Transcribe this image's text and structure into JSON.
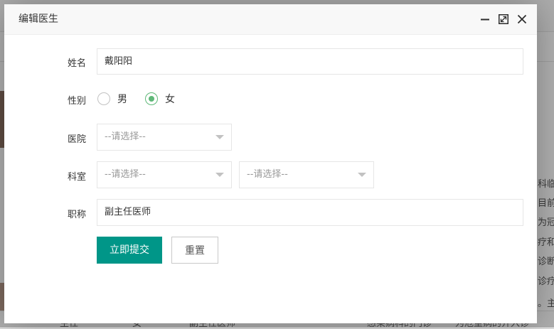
{
  "dialog": {
    "title": "编辑医生",
    "controls": [
      "minimize-icon",
      "maximize-icon",
      "close-icon"
    ]
  },
  "form": {
    "name": {
      "label": "姓名",
      "value": "戴阳阳"
    },
    "gender": {
      "label": "性别",
      "options": [
        {
          "label": "男",
          "checked": false
        },
        {
          "label": "女",
          "checked": true
        }
      ]
    },
    "hospital": {
      "label": "医院",
      "placeholder": "--请选择--"
    },
    "department": {
      "label": "科室",
      "placeholder_1": "--请选择--",
      "placeholder_2": "--请选择--"
    },
    "title": {
      "label": "职称",
      "value": "副主任医师"
    },
    "submit_label": "立即提交",
    "reset_label": "重置"
  },
  "background": {
    "right_text": [
      "科临",
      "目前",
      "为冠",
      "疗和",
      "诊断",
      "诊疗",
      "。主",
      "入诊"
    ],
    "bottom_row": [
      "主任",
      "女",
      "副主任医师",
      "感染病科的门诊",
      "为危重病的介入诊"
    ]
  },
  "colors": {
    "primary": "#009688",
    "radio_checked": "#5FB878",
    "overlay": "rgba(0,0,0,0.30)"
  }
}
